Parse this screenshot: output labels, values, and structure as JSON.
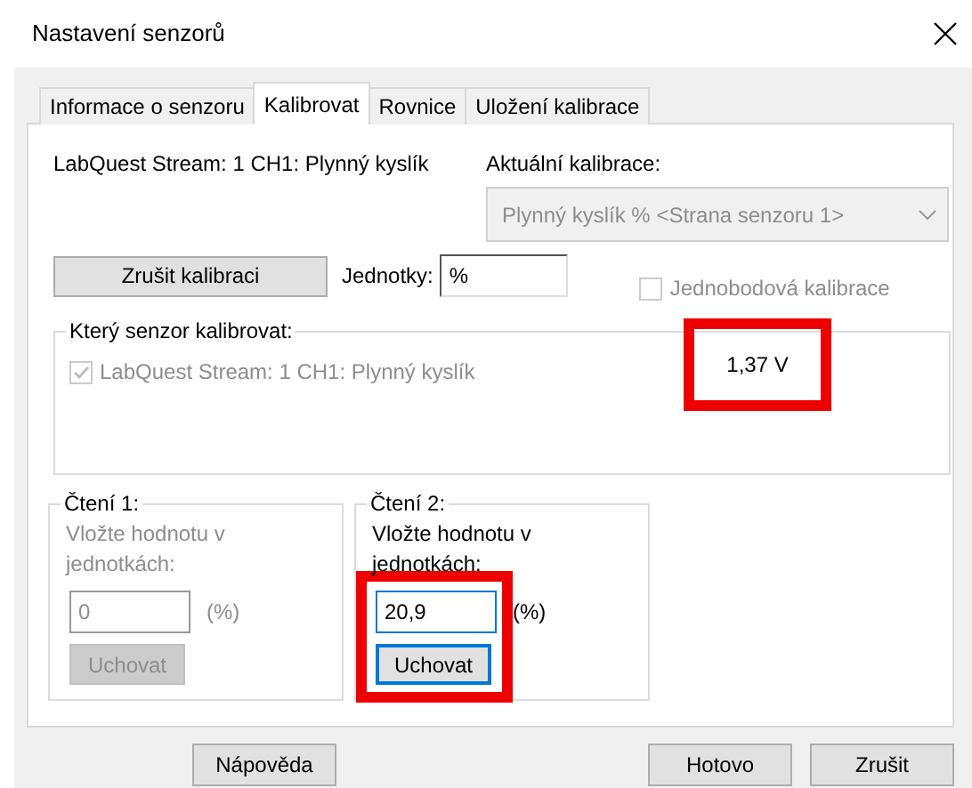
{
  "window": {
    "title": "Nastavení senzorů"
  },
  "tabs": [
    {
      "label": "Informace o senzoru",
      "selected": false
    },
    {
      "label": "Kalibrovat",
      "selected": true
    },
    {
      "label": "Rovnice",
      "selected": false
    },
    {
      "label": "Uložení kalibrace",
      "selected": false
    }
  ],
  "sensor_name": "LabQuest Stream: 1 CH1: Plynný kyslík",
  "current_calibration": {
    "label": "Aktuální kalibrace:",
    "value": "Plynný kyslík % <Strana senzoru 1>",
    "disabled": true
  },
  "cancel_calibration_button": "Zrušit kalibraci",
  "units": {
    "label": "Jednotky:",
    "value": "%"
  },
  "single_point": {
    "label": "Jednobodová kalibrace",
    "checked": false,
    "disabled": true
  },
  "sensor_group": {
    "legend": "Který senzor kalibrovat:",
    "sensors": [
      {
        "label": "LabQuest Stream: 1 CH1: Plynný kyslík",
        "checked": true,
        "disabled": true
      }
    ],
    "reading": "1,37 V",
    "highlighted": true
  },
  "readings": [
    {
      "title": "Čtení 1:",
      "prompt": "Vložte hodnotu v jednotkách:",
      "value": "0",
      "unit": "(%)",
      "button": "Uchovat",
      "disabled": true,
      "highlighted": false
    },
    {
      "title": "Čtení 2:",
      "prompt": "Vložte hodnotu v jednotkách:",
      "value": "20,9",
      "unit": "(%)",
      "button": "Uchovat",
      "disabled": false,
      "highlighted": true
    }
  ],
  "buttons": [
    "Nápověda",
    "Hotovo",
    "Zrušit"
  ]
}
